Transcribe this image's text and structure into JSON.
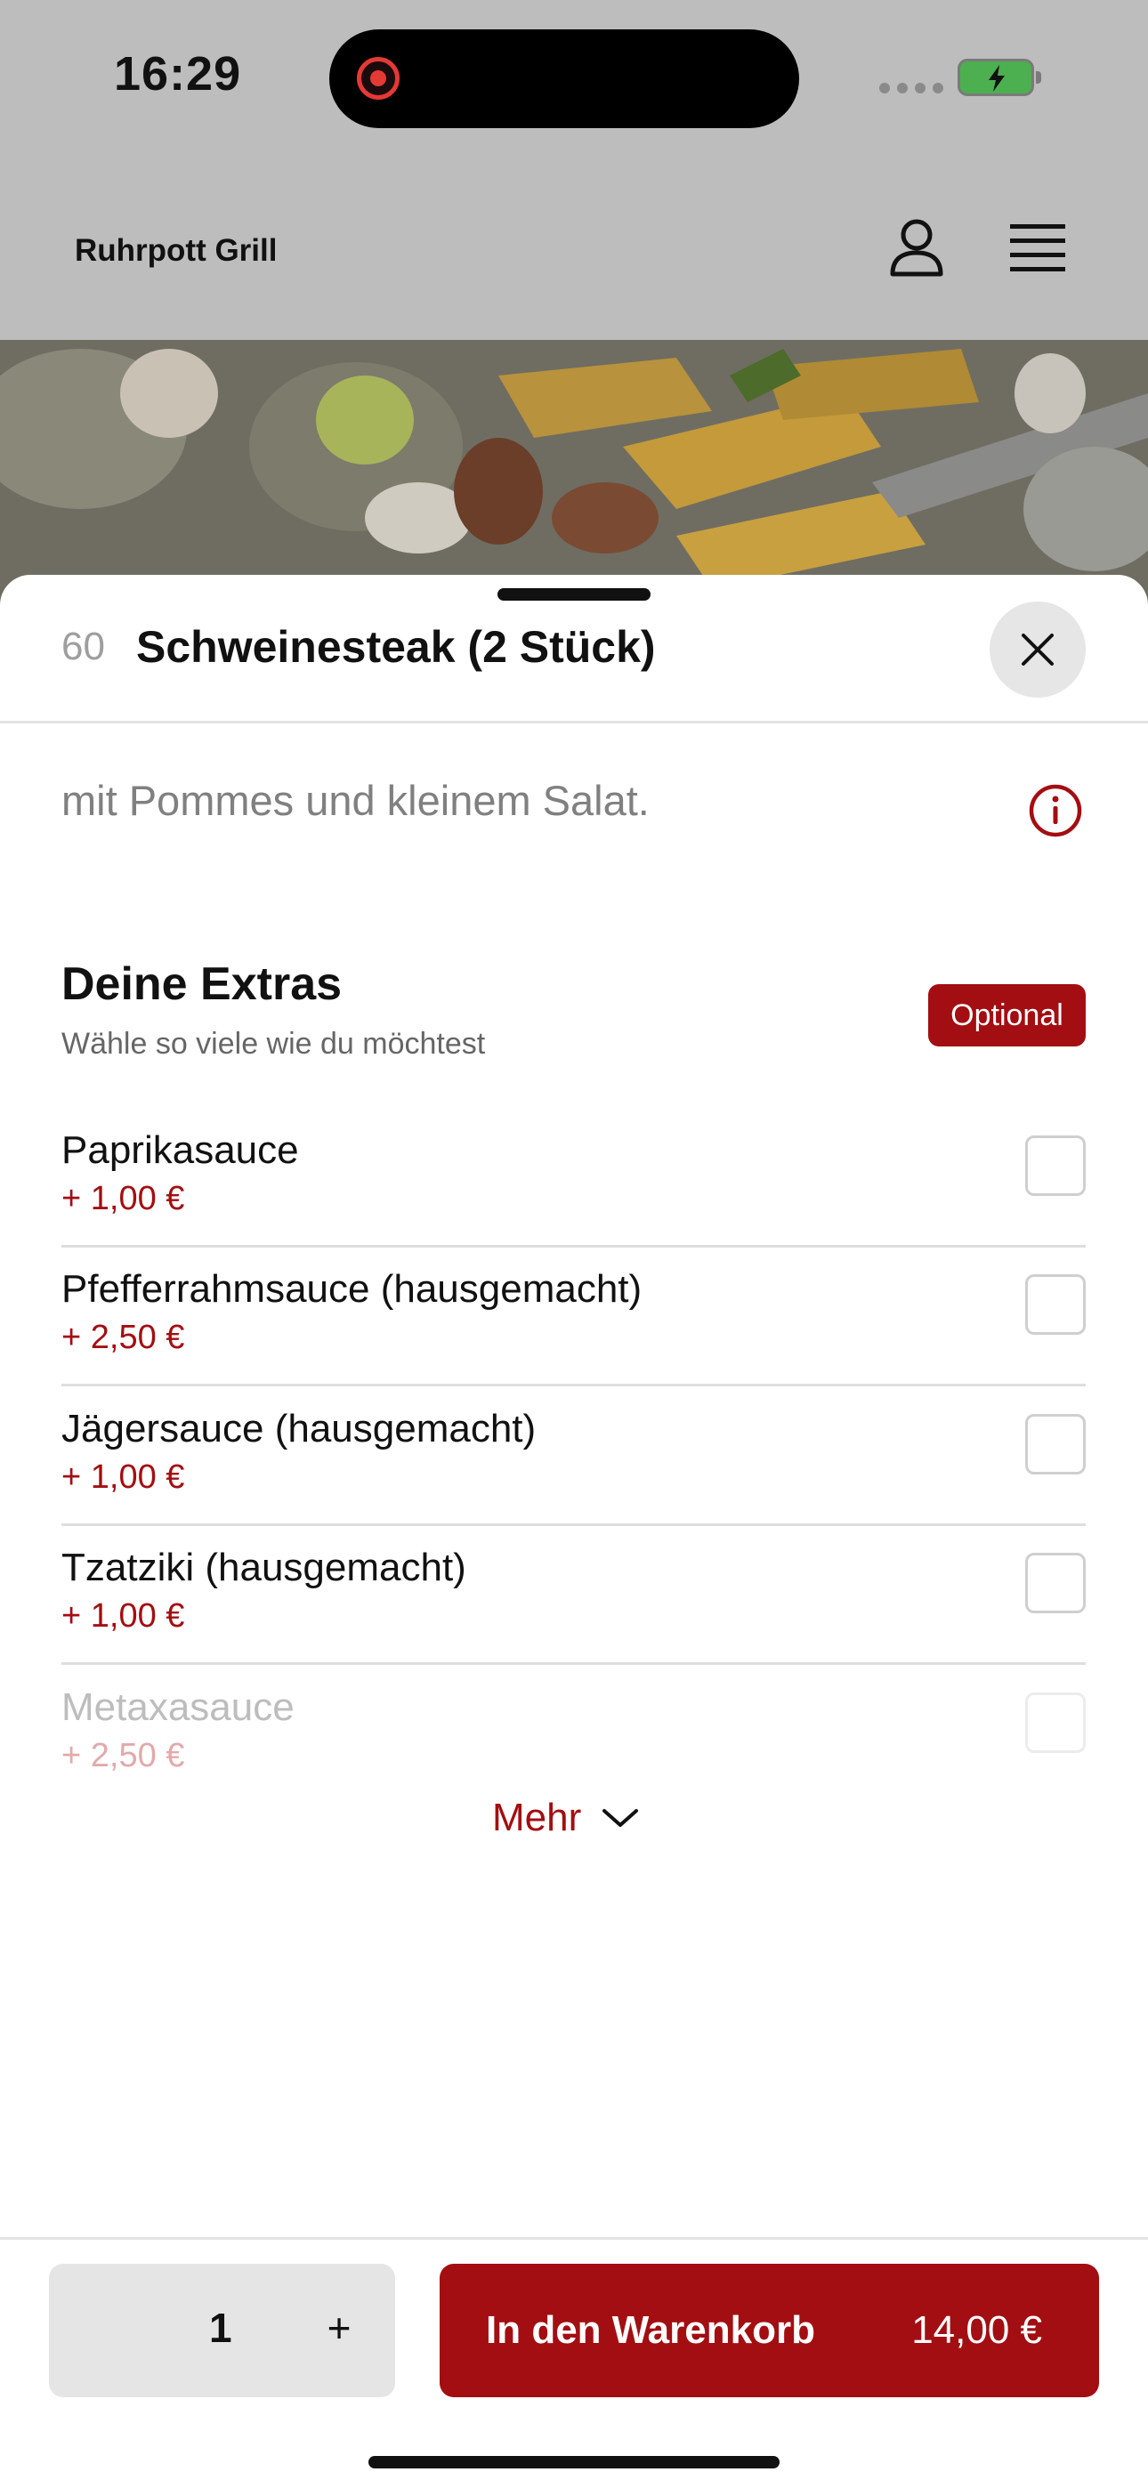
{
  "status_bar": {
    "time": "16:29"
  },
  "header": {
    "brand": "Ruhrpott Grill"
  },
  "item": {
    "number": "60",
    "title": "Schweinesteak (2 Stück)",
    "description": "mit Pommes und kleinem Salat."
  },
  "extras": {
    "title": "Deine Extras",
    "subtitle": "Wähle so viele wie du möchtest",
    "badge": "Optional",
    "options": [
      {
        "name": "Paprikasauce",
        "price": "+ 1,00 €"
      },
      {
        "name": "Pfefferrahmsauce (hausgemacht)",
        "price": "+ 2,50 €"
      },
      {
        "name": "Jägersauce (hausgemacht)",
        "price": "+ 1,00 €"
      },
      {
        "name": "Tzatziki (hausgemacht)",
        "price": "+ 1,00 €"
      },
      {
        "name": "Metaxasauce",
        "price": "+ 2,50 €"
      }
    ],
    "more_label": "Mehr"
  },
  "footer": {
    "quantity": "1",
    "plus_label": "+",
    "cart_label": "In den Warenkorb",
    "cart_price": "14,00 €"
  },
  "colors": {
    "accent": "#a30e12",
    "overlay": "#bdbdbd"
  },
  "icons": [
    "user-icon",
    "menu-icon",
    "close-icon",
    "info-icon",
    "chevron-down-icon"
  ]
}
